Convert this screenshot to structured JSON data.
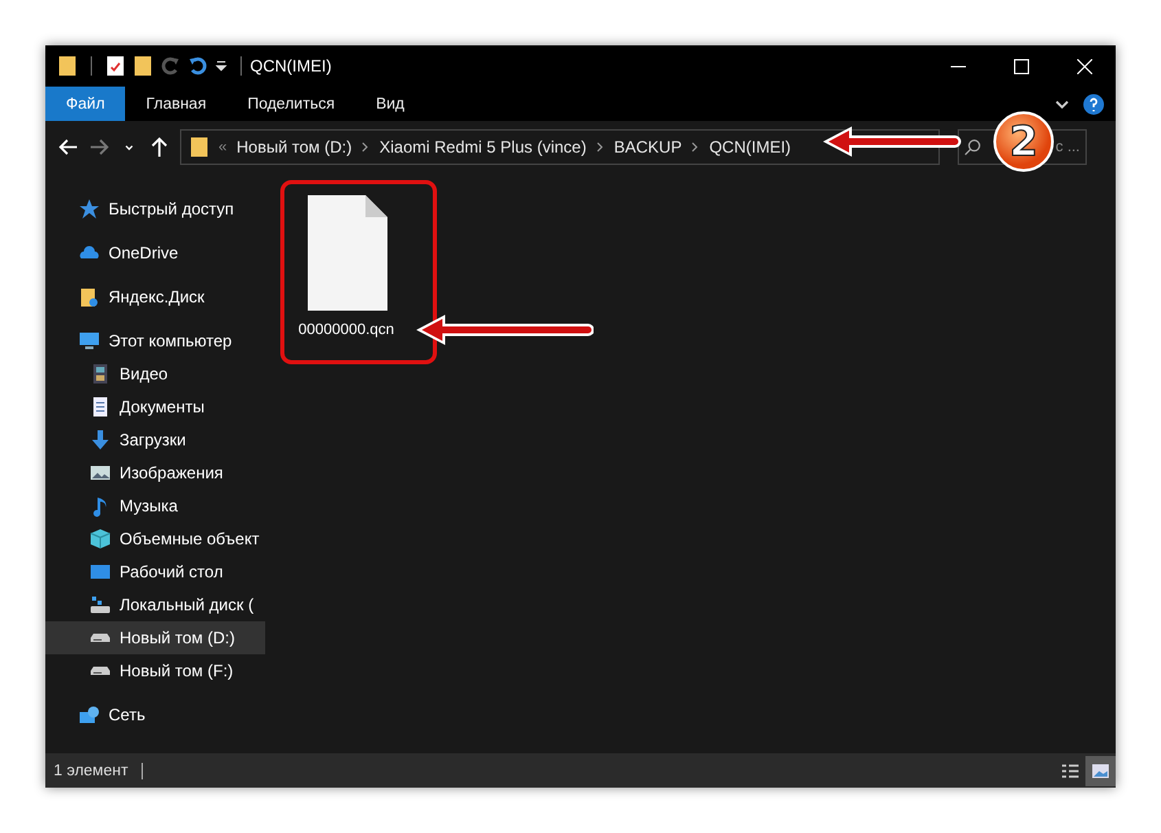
{
  "window": {
    "title": "QCN(IMEI)"
  },
  "ribbon_tabs": [
    {
      "label": "Файл",
      "selected": true
    },
    {
      "label": "Главная",
      "selected": false
    },
    {
      "label": "Поделиться",
      "selected": false
    },
    {
      "label": "Вид",
      "selected": false
    }
  ],
  "nav_buttons": [
    {
      "kind": "back",
      "disabled": false
    },
    {
      "kind": "forward",
      "disabled": true
    },
    {
      "kind": "recent",
      "disabled": false
    },
    {
      "kind": "up",
      "disabled": false
    }
  ],
  "address": {
    "overflow_mark": "«",
    "crumbs": [
      "Новый том (D:)",
      "Xiaomi Redmi 5 Plus (vince)",
      "BACKUP",
      "QCN(IMEI)"
    ]
  },
  "search": {
    "visible_text": "с ..."
  },
  "sidebar": {
    "items": [
      {
        "label": "Быстрый доступ",
        "kind": "star",
        "selected": false
      },
      {
        "label": "OneDrive",
        "kind": "cloud",
        "selected": false
      },
      {
        "label": "Яндекс.Диск",
        "kind": "folder",
        "selected": false
      },
      {
        "label": "Этот компьютер",
        "kind": "computer",
        "selected": false,
        "children": [
          {
            "label": "Видео",
            "kind": "video",
            "selected": false
          },
          {
            "label": "Документы",
            "kind": "docs",
            "selected": false
          },
          {
            "label": "Загрузки",
            "kind": "download",
            "selected": false
          },
          {
            "label": "Изображения",
            "kind": "pictures",
            "selected": false
          },
          {
            "label": "Музыка",
            "kind": "music",
            "selected": false
          },
          {
            "label": "Объемные объект",
            "kind": "objects",
            "selected": false
          },
          {
            "label": "Рабочий стол",
            "kind": "desktop",
            "selected": false
          },
          {
            "label": "Локальный диск (",
            "kind": "localdisk",
            "selected": false
          },
          {
            "label": "Новый том (D:)",
            "kind": "drive",
            "selected": true
          },
          {
            "label": "Новый том (F:)",
            "kind": "drive",
            "selected": false
          }
        ]
      },
      {
        "label": "Сеть",
        "kind": "network",
        "selected": false
      }
    ]
  },
  "files": [
    {
      "name": "00000000.qcn"
    }
  ],
  "annotations": {
    "step_badge": "2"
  },
  "status_bar": {
    "count": "1 элемент",
    "views": [
      {
        "kind": "details",
        "selected": false
      },
      {
        "kind": "large_icons",
        "selected": true
      }
    ]
  }
}
